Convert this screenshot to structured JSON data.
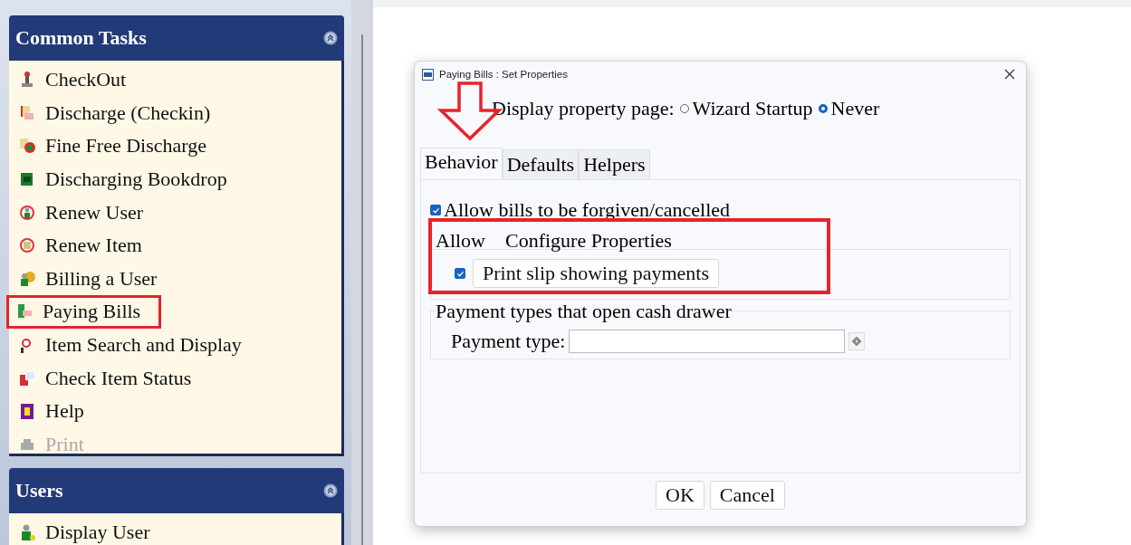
{
  "sidebar": {
    "panels": [
      {
        "title": "Common Tasks",
        "items": [
          {
            "label": "CheckOut",
            "highlighted": false,
            "disabled": false
          },
          {
            "label": "Discharge (Checkin)",
            "highlighted": false,
            "disabled": false
          },
          {
            "label": "Fine Free Discharge",
            "highlighted": false,
            "disabled": false
          },
          {
            "label": "Discharging Bookdrop",
            "highlighted": false,
            "disabled": false
          },
          {
            "label": "Renew User",
            "highlighted": false,
            "disabled": false
          },
          {
            "label": "Renew Item",
            "highlighted": false,
            "disabled": false
          },
          {
            "label": "Billing a User",
            "highlighted": false,
            "disabled": false
          },
          {
            "label": "Paying Bills",
            "highlighted": true,
            "disabled": false
          },
          {
            "label": "Item Search and Display",
            "highlighted": false,
            "disabled": false
          },
          {
            "label": "Check Item Status",
            "highlighted": false,
            "disabled": false
          },
          {
            "label": "Help",
            "highlighted": false,
            "disabled": false
          },
          {
            "label": "Print",
            "highlighted": false,
            "disabled": true
          }
        ]
      },
      {
        "title": "Users",
        "items": [
          {
            "label": "Display User",
            "highlighted": false,
            "disabled": false
          }
        ]
      }
    ]
  },
  "dialog": {
    "title": "Paying Bills : Set Properties",
    "display_label": "Display property page:",
    "display_options": [
      {
        "label": "Wizard Startup",
        "selected": false
      },
      {
        "label": "Never",
        "selected": true
      }
    ],
    "tabs": [
      {
        "label": "Behavior",
        "selected": true,
        "pointed": true
      },
      {
        "label": "Defaults",
        "selected": false,
        "pointed": false
      },
      {
        "label": "Helpers",
        "selected": false,
        "pointed": false
      }
    ],
    "allow_forgive": {
      "label": "Allow bills to be forgiven/cancelled",
      "checked": true
    },
    "properties_group": {
      "highlighted": true,
      "column_1": "Allow",
      "column_2": "Configure Properties",
      "rows": [
        {
          "label": "Print slip showing payments",
          "checked": true
        }
      ]
    },
    "cash_drawer_group": {
      "title": "Payment types that open cash drawer",
      "field_label": "Payment type:"
    },
    "buttons": [
      "OK",
      "Cancel"
    ]
  }
}
